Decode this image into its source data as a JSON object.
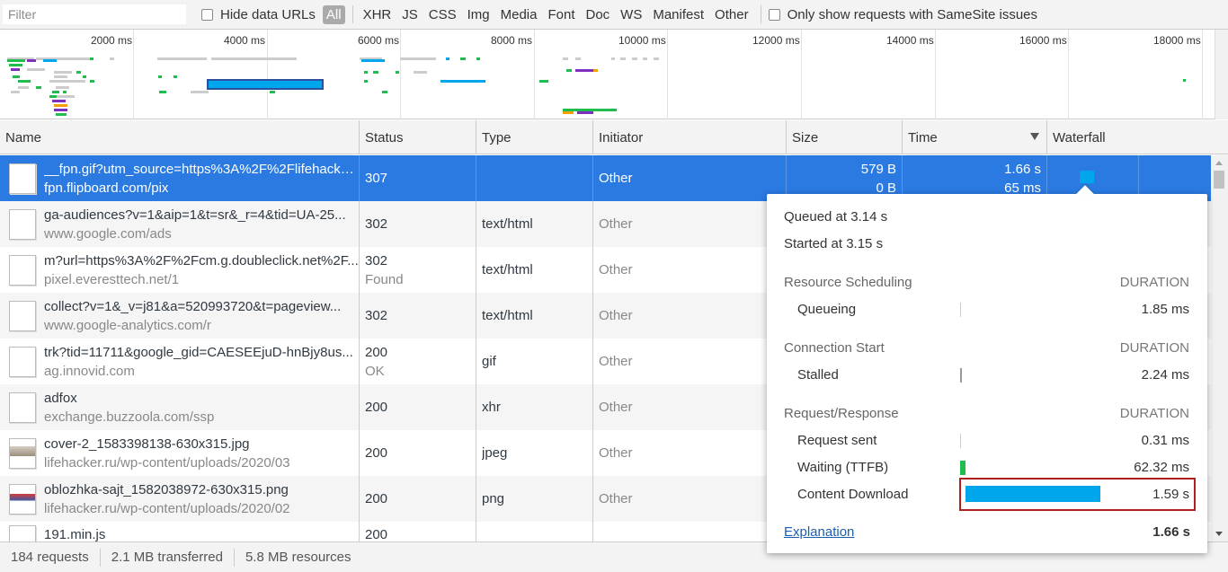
{
  "filterbar": {
    "filter_placeholder": "Filter",
    "hide_data_urls_label": "Hide data URLs",
    "types": [
      "All",
      "XHR",
      "JS",
      "CSS",
      "Img",
      "Media",
      "Font",
      "Doc",
      "WS",
      "Manifest",
      "Other"
    ],
    "samesite_label": "Only show requests with SameSite issues"
  },
  "overview": {
    "ticks": [
      "2000 ms",
      "4000 ms",
      "6000 ms",
      "8000 ms",
      "10000 ms",
      "12000 ms",
      "14000 ms",
      "16000 ms",
      "18000 ms"
    ]
  },
  "columns": {
    "name": "Name",
    "status": "Status",
    "type": "Type",
    "initiator": "Initiator",
    "size": "Size",
    "time": "Time",
    "waterfall": "Waterfall"
  },
  "rows": [
    {
      "name": "__fpn.gif?utm_source=https%3A%2F%2Flifehacker....",
      "domain": "fpn.flipboard.com/pix",
      "status": "307",
      "status_text": "",
      "type": "",
      "initiator": "Other",
      "size": "579 B",
      "size2": "0 B",
      "time": "1.66 s",
      "time2": "65 ms"
    },
    {
      "name": "ga-audiences?v=1&aip=1&t=sr&_r=4&tid=UA-25...",
      "domain": "www.google.com/ads",
      "status": "302",
      "status_text": "",
      "type": "text/html",
      "initiator": "Other"
    },
    {
      "name": "m?url=https%3A%2F%2Fcm.g.doubleclick.net%2F...",
      "domain": "pixel.everesttech.net/1",
      "status": "302",
      "status_text": "Found",
      "type": "text/html",
      "initiator": "Other"
    },
    {
      "name": "collect?v=1&_v=j81&a=520993720&t=pageview...",
      "domain": "www.google-analytics.com/r",
      "status": "302",
      "status_text": "",
      "type": "text/html",
      "initiator": "Other"
    },
    {
      "name": "trk?tid=11711&google_gid=CAESEEjuD-hnBjy8us...",
      "domain": "ag.innovid.com",
      "status": "200",
      "status_text": "OK",
      "type": "gif",
      "initiator": "Other"
    },
    {
      "name": "adfox",
      "domain": "exchange.buzzoola.com/ssp",
      "status": "200",
      "status_text": "",
      "type": "xhr",
      "initiator": "Other"
    },
    {
      "name": "cover-2_1583398138-630x315.jpg",
      "domain": "lifehacker.ru/wp-content/uploads/2020/03",
      "status": "200",
      "status_text": "",
      "type": "jpeg",
      "initiator": "Other"
    },
    {
      "name": "oblozhka-sajt_1582038972-630x315.png",
      "domain": "lifehacker.ru/wp-content/uploads/2020/02",
      "status": "200",
      "status_text": "",
      "type": "png",
      "initiator": "Other"
    },
    {
      "name": "191.min.js",
      "domain": "",
      "status": "200",
      "status_text": "",
      "type": "",
      "initiator": ""
    }
  ],
  "statusbar": {
    "requests": "184 requests",
    "transferred": "2.1 MB transferred",
    "resources": "5.8 MB resources"
  },
  "timing": {
    "queued": "Queued at 3.14 s",
    "started": "Started at 3.15 s",
    "duration_label": "DURATION",
    "resource_scheduling": "Resource Scheduling",
    "queueing_label": "Queueing",
    "queueing_val": "1.85 ms",
    "connection_start": "Connection Start",
    "stalled_label": "Stalled",
    "stalled_val": "2.24 ms",
    "request_response": "Request/Response",
    "request_sent_label": "Request sent",
    "request_sent_val": "0.31 ms",
    "waiting_label": "Waiting (TTFB)",
    "waiting_val": "62.32 ms",
    "content_download_label": "Content Download",
    "content_download_val": "1.59 s",
    "explanation": "Explanation",
    "total": "1.66 s"
  },
  "colors": {
    "selected_row": "#2a7ae2",
    "download_bar": "#00a6ec",
    "ttfb_bar": "#1fbd4e",
    "highlight_border": "#b01e1e"
  }
}
